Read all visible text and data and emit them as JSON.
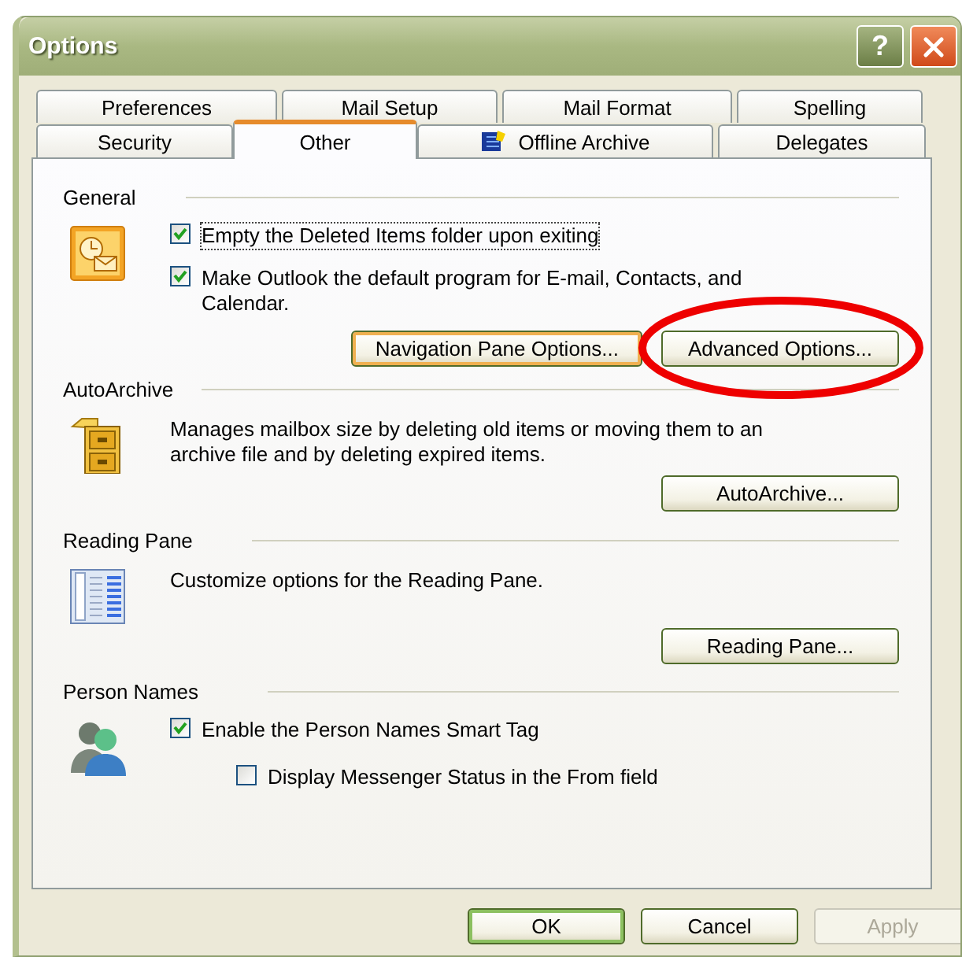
{
  "window": {
    "title": "Options",
    "title_buttons": [
      {
        "kind": "help",
        "label": "?"
      },
      {
        "kind": "close"
      }
    ]
  },
  "tab_rows": [
    {
      "tabs": [
        {
          "label": "Preferences",
          "selected": false,
          "icon": false
        },
        {
          "label": "Mail Setup",
          "selected": false,
          "icon": false
        },
        {
          "label": "Mail Format",
          "selected": false,
          "icon": false
        },
        {
          "label": "Spelling",
          "selected": false,
          "icon": false
        }
      ]
    },
    {
      "tabs": [
        {
          "label": "Security",
          "selected": false,
          "icon": false
        },
        {
          "label": "Other",
          "selected": true,
          "icon": false
        },
        {
          "label": "Offline Archive",
          "selected": false,
          "icon": true
        },
        {
          "label": "Delegates",
          "selected": false,
          "icon": false
        }
      ]
    }
  ],
  "sections": [
    {
      "title": "General",
      "items": [
        {
          "kind": "checkbox",
          "label": "Empty the Deleted Items folder upon exiting",
          "checked": true,
          "focused": true
        },
        {
          "kind": "checkbox",
          "label": "Make Outlook the default program for E-mail, Contacts, and Calendar.",
          "checked": true,
          "focused": false
        },
        {
          "kind": "buttons",
          "buttons": [
            {
              "label": "Navigation Pane Options...",
              "focused": true,
              "circled": false
            },
            {
              "label": "Advanced Options...",
              "focused": false,
              "circled": true
            }
          ]
        }
      ]
    },
    {
      "title": "AutoArchive",
      "items": [
        {
          "kind": "text",
          "text": "Manages mailbox size by deleting old items or moving them to an archive file and by deleting expired items."
        },
        {
          "kind": "buttons",
          "buttons": [
            {
              "label": "AutoArchive...",
              "focused": false,
              "circled": false
            }
          ]
        }
      ]
    },
    {
      "title": "Reading Pane",
      "items": [
        {
          "kind": "text",
          "text": "Customize options for the Reading Pane."
        },
        {
          "kind": "buttons",
          "buttons": [
            {
              "label": "Reading Pane...",
              "focused": false,
              "circled": false
            }
          ]
        }
      ]
    },
    {
      "title": "Person Names",
      "items": [
        {
          "kind": "checkbox",
          "label": "Enable the Person Names Smart Tag",
          "checked": true,
          "focused": false,
          "children": [
            {
              "kind": "checkbox",
              "label": "Display Messenger Status in the From field",
              "checked": false,
              "focused": false
            }
          ]
        }
      ]
    }
  ],
  "footer_buttons": [
    {
      "label": "OK",
      "default": true,
      "disabled": false
    },
    {
      "label": "Cancel",
      "default": false,
      "disabled": false
    },
    {
      "label": "Apply",
      "default": false,
      "disabled": true
    }
  ]
}
